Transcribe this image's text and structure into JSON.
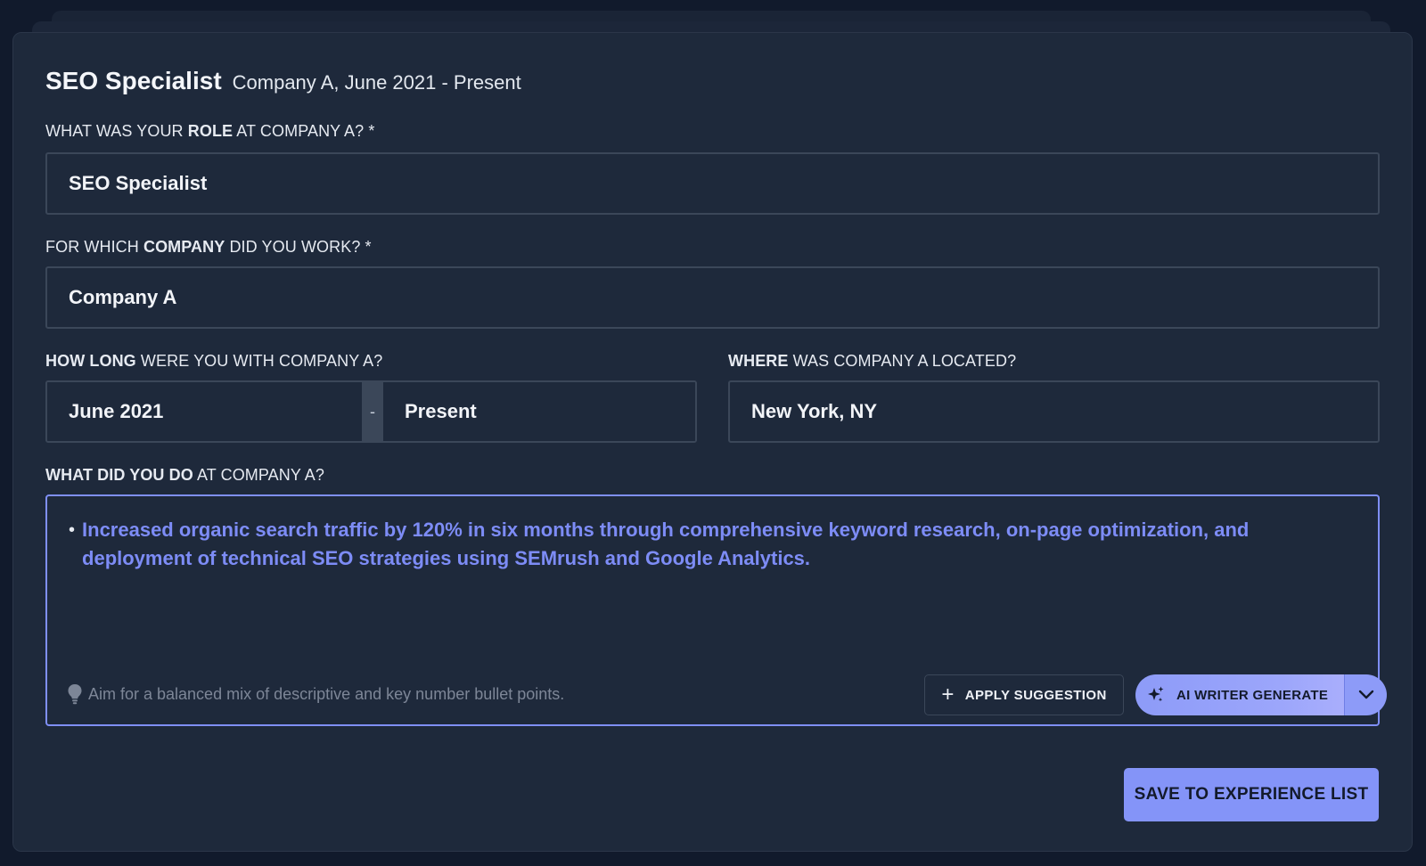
{
  "header": {
    "title": "SEO Specialist",
    "subtitle": "Company A, June 2021 - Present"
  },
  "role": {
    "label_prefix": "WHAT WAS YOUR ",
    "label_bold": "ROLE",
    "label_suffix": " AT COMPANY A? *",
    "value": "SEO Specialist"
  },
  "company": {
    "label_prefix": "FOR WHICH ",
    "label_bold": "COMPANY",
    "label_suffix": " DID YOU WORK? *",
    "value": "Company A"
  },
  "duration": {
    "label_bold": "HOW LONG",
    "label_suffix": " WERE YOU WITH COMPANY A?",
    "start": "June 2021",
    "separator": "-",
    "end": "Present"
  },
  "location": {
    "label_bold": "WHERE",
    "label_suffix": " WAS COMPANY A LOCATED?",
    "value": "New York, NY"
  },
  "description": {
    "label_bold": "WHAT DID YOU DO",
    "label_suffix": " AT COMPANY A?",
    "bullet": "•",
    "bullet_text": "Increased organic search traffic by 120% in six months through comprehensive keyword research, on-page optimization, and deployment of technical SEO strategies using SEMrush and Google Analytics.",
    "hint": "Aim for a balanced mix of descriptive and key number bullet points."
  },
  "actions": {
    "apply_label": "APPLY SUGGESTION",
    "ai_label": "AI WRITER GENERATE",
    "save_label": "SAVE TO EXPERIENCE LIST"
  },
  "icons": {
    "plus": "+"
  },
  "colors": {
    "accent": "#8494f8",
    "suggestion_text": "#7d8cf6",
    "background": "#1e293b"
  }
}
